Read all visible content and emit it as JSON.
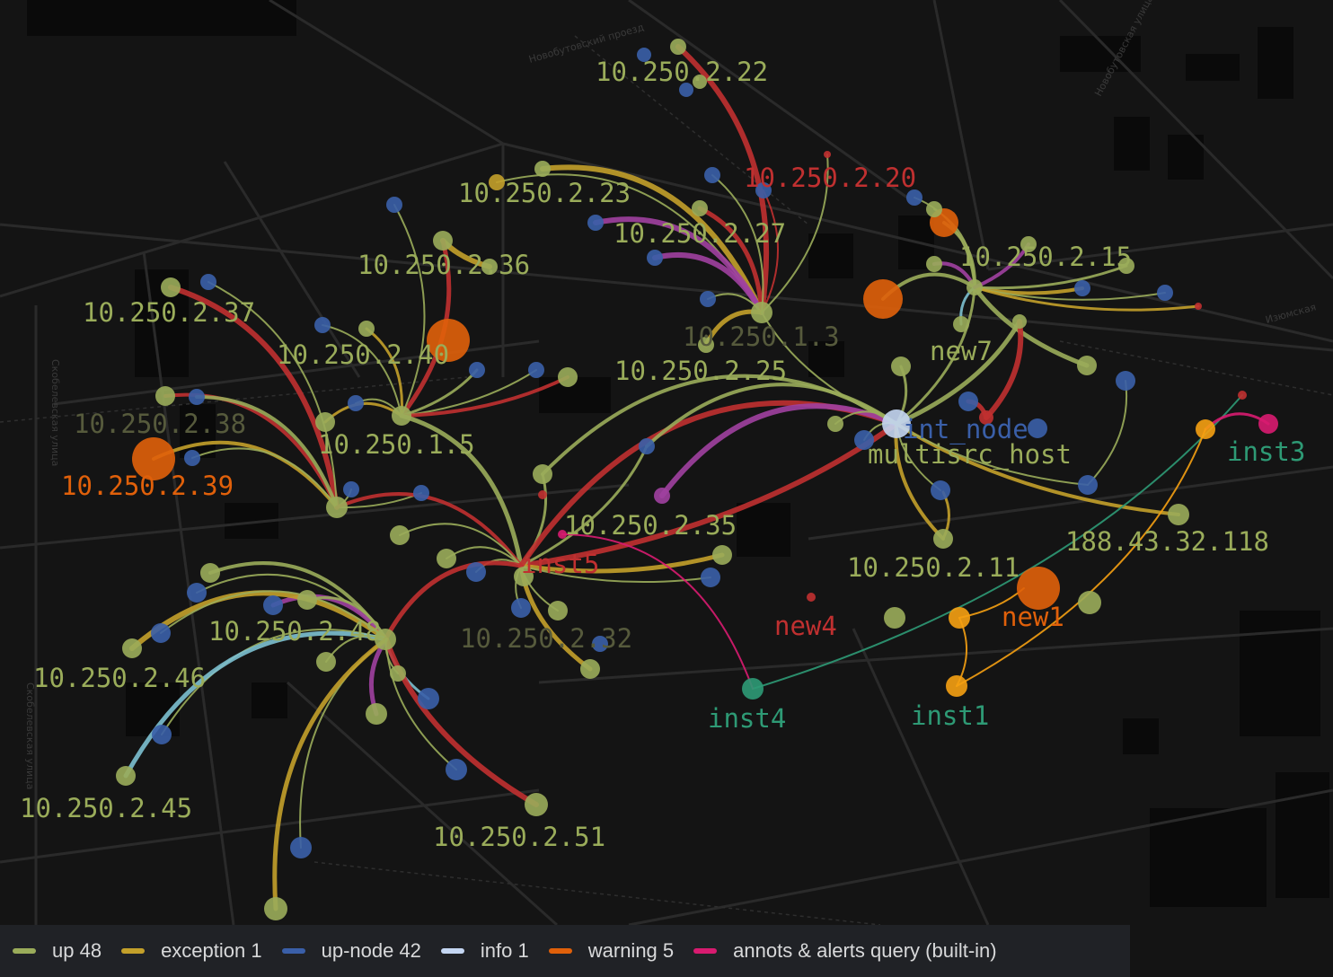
{
  "colors": {
    "up": "#9aac5a",
    "exception": "#c3a02a",
    "up_node": "#3a5fa8",
    "info": "#c4d6f2",
    "warning": "#e0600a",
    "annots": "#d81b70",
    "red": "#c03030",
    "teal": "#2e9a75",
    "orange": "#f5a012",
    "purple": "#a040a0",
    "lightblue": "#7cc0d0"
  },
  "legend": [
    {
      "label": "up 48",
      "color": "#9aac5a"
    },
    {
      "label": "exception 1",
      "color": "#c3a02a"
    },
    {
      "label": "up-node 42",
      "color": "#3a5fa8"
    },
    {
      "label": "info 1",
      "color": "#c4d6f2"
    },
    {
      "label": "warning 5",
      "color": "#e0600a"
    },
    {
      "label": "annots & alerts query (built-in)",
      "color": "#d81b70"
    }
  ],
  "street_labels": [
    "Новобутовский проезд",
    "Новобутовская улица",
    "Изюмская",
    "Скобелевская улица",
    "Скобелевская улица"
  ],
  "hubs": [
    {
      "label": "10.250.2.22",
      "color": "#9aac5a"
    },
    {
      "label": "10.250.2.20",
      "color": "#c03030"
    },
    {
      "label": "10.250.2.23",
      "color": "#9aac5a"
    },
    {
      "label": "10.250.2.27",
      "color": "#9aac5a"
    },
    {
      "label": "10.250.2.36",
      "color": "#9aac5a"
    },
    {
      "label": "10.250.2.15",
      "color": "#9aac5a"
    },
    {
      "label": "10.250.2.37",
      "color": "#9aac5a"
    },
    {
      "label": "10.250.2.40",
      "color": "#9aac5a"
    },
    {
      "label": "10.250.2.25",
      "color": "#9aac5a"
    },
    {
      "label": "10.250.1.3",
      "color": "#565a3c"
    },
    {
      "label": "new7",
      "color": "#9aac5a"
    },
    {
      "label": "10.250.2.38",
      "color": "#565a3c"
    },
    {
      "label": "10.250.1.5",
      "color": "#9aac5a"
    },
    {
      "label": "10.250.2.39",
      "color": "#e0600a"
    },
    {
      "label": "int_node",
      "color": "#3a5fa8"
    },
    {
      "label": "multisrc_host",
      "color": "#9aac5a"
    },
    {
      "label": "inst3",
      "color": "#2e9a75"
    },
    {
      "label": "10.250.2.35",
      "color": "#9aac5a"
    },
    {
      "label": "inst5",
      "color": "#c03030"
    },
    {
      "label": "188.43.32.118",
      "color": "#9aac5a"
    },
    {
      "label": "10.250.2.11",
      "color": "#9aac5a"
    },
    {
      "label": "new1",
      "color": "#e0600a"
    },
    {
      "label": "10.250.2.48",
      "color": "#9aac5a"
    },
    {
      "label": "10.250.2.32",
      "color": "#565a3c"
    },
    {
      "label": "new4",
      "color": "#c03030"
    },
    {
      "label": "10.250.2.46",
      "color": "#9aac5a"
    },
    {
      "label": "inst4",
      "color": "#2e9a75"
    },
    {
      "label": "inst1",
      "color": "#2e9a75"
    },
    {
      "label": "10.250.2.45",
      "color": "#9aac5a"
    },
    {
      "label": "10.250.2.51",
      "color": "#9aac5a"
    }
  ]
}
